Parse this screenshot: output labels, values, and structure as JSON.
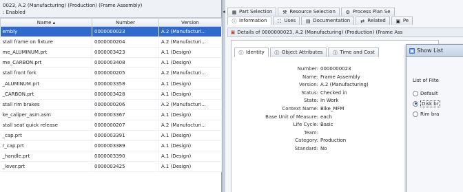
{
  "left_panel": {
    "header_line1": "0023, A.2 (Manufacturing) (Production) (Frame Assembly)",
    "header_line2": ": Enabled",
    "columns": [
      "Name ▴",
      "Number",
      "Version"
    ],
    "rows": [
      {
        "name": "embly",
        "number": "0000000023",
        "version": "A.2 (Manufacturi...",
        "selected": true
      },
      {
        "name": "stall frame on fixture",
        "number": "0000000204",
        "version": "A.2 (Manufacturi..."
      },
      {
        "name": "me_ALUMINUM.prt",
        "number": "0000003423",
        "version": "A.1 (Design)"
      },
      {
        "name": "me_CARBON.prt",
        "number": "0000003408",
        "version": "A.1 (Design)"
      },
      {
        "name": "stall front fork",
        "number": "0000000205",
        "version": "A.2 (Manufacturi..."
      },
      {
        "name": "_ALUMINUM.prt",
        "number": "0000003358",
        "version": "A.1 (Design)"
      },
      {
        "name": "_CARBON.prt",
        "number": "0000003428",
        "version": "A.1 (Design)"
      },
      {
        "name": "stall rim brakes",
        "number": "0000000206",
        "version": "A.2 (Manufacturi..."
      },
      {
        "name": "ke_caliper_asm.asm",
        "number": "0000003367",
        "version": "A.1 (Design)"
      },
      {
        "name": "stall seat quick release",
        "number": "0000000207",
        "version": "A.2 (Manufacturi..."
      },
      {
        "name": "_cap.prt",
        "number": "0000003391",
        "version": "A.1 (Design)"
      },
      {
        "name": "r_cap.prt",
        "number": "0000003389",
        "version": "A.1 (Design)"
      },
      {
        "name": "_handle.prt",
        "number": "0000003390",
        "version": "A.1 (Design)"
      },
      {
        "name": "_lever.prt",
        "number": "0000003425",
        "version": "A.1 (Design)"
      }
    ]
  },
  "right_panel": {
    "tabs_top": [
      "Part Selection",
      "Resource Selection",
      "Process Plan Se"
    ],
    "tabs_bottom": [
      "Information",
      "Uses",
      "Documentation",
      "Related",
      "Pe"
    ],
    "details_title": "Details of 0000000023, A.2 (Manufacturing) (Production) (Frame Ass",
    "inner_tabs": [
      "Identity",
      "Object Attributes",
      "Time and Cost"
    ],
    "properties": [
      {
        "label": "Number:",
        "value": "0000000023"
      },
      {
        "label": "Name:",
        "value": "Frame Assembly"
      },
      {
        "label": "Version:",
        "value": "A.2 (Manufacturing)"
      },
      {
        "label": "Status:",
        "value": "Checked in"
      },
      {
        "label": "State:",
        "value": "In Work"
      },
      {
        "label": "Context Name:",
        "value": "Bike_MFM"
      },
      {
        "label": "Base Unit of Measure:",
        "value": "each"
      },
      {
        "label": "Life Cycle:",
        "value": "Basic"
      },
      {
        "label": "Team:",
        "value": ""
      },
      {
        "label": "Category:",
        "value": "Production"
      },
      {
        "label": "Standard:",
        "value": "No"
      }
    ]
  },
  "dialog": {
    "title": "Show List",
    "list_label": "List of Filte",
    "options": [
      {
        "label": "Default",
        "checked": false
      },
      {
        "label": "Disk br",
        "checked": true
      },
      {
        "label": "Rim bra",
        "checked": false
      }
    ]
  }
}
